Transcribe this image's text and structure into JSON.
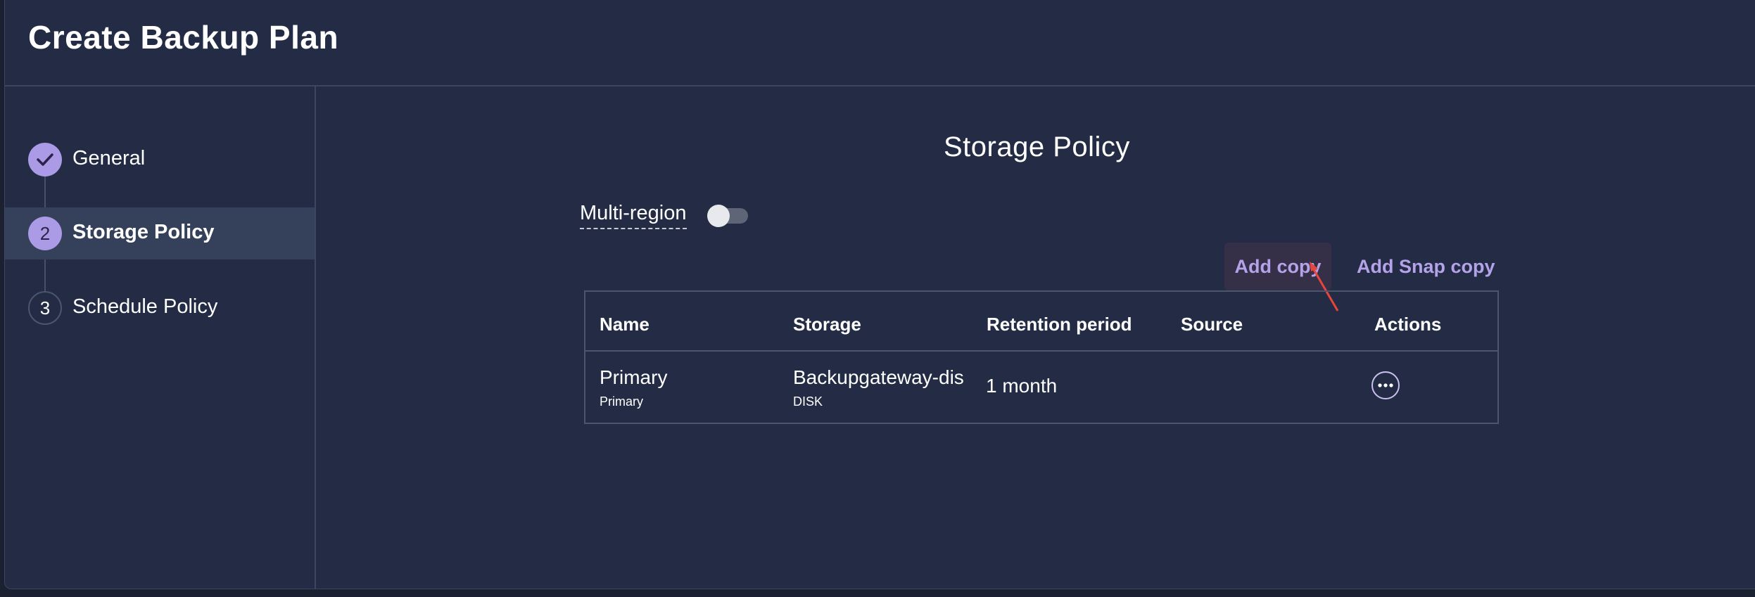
{
  "header": {
    "title": "Create Backup Plan"
  },
  "steps": [
    {
      "number": "1",
      "label": "General",
      "state": "done",
      "icon": "check-icon"
    },
    {
      "number": "2",
      "label": "Storage Policy",
      "state": "current"
    },
    {
      "number": "3",
      "label": "Schedule Policy",
      "state": "todo"
    }
  ],
  "main": {
    "title": "Storage Policy",
    "multi_region": {
      "label": "Multi-region",
      "enabled": false
    },
    "buttons": {
      "add_copy": "Add copy",
      "add_snap_copy": "Add Snap copy"
    },
    "table": {
      "columns": [
        "Name",
        "Storage",
        "Retention period",
        "Source",
        "Actions"
      ],
      "rows": [
        {
          "name": "Primary",
          "name_sub": "Primary",
          "storage": "Backupgateway-dis",
          "storage_sub": "DISK",
          "retention": "1 month",
          "source": "",
          "action_icon": "more-horizontal-icon"
        }
      ]
    }
  },
  "colors": {
    "background": "#232c44",
    "accent": "#ab9be6",
    "link": "#b4a3e8",
    "border": "#3b4660",
    "cursor_arrow": "#e8453c"
  }
}
